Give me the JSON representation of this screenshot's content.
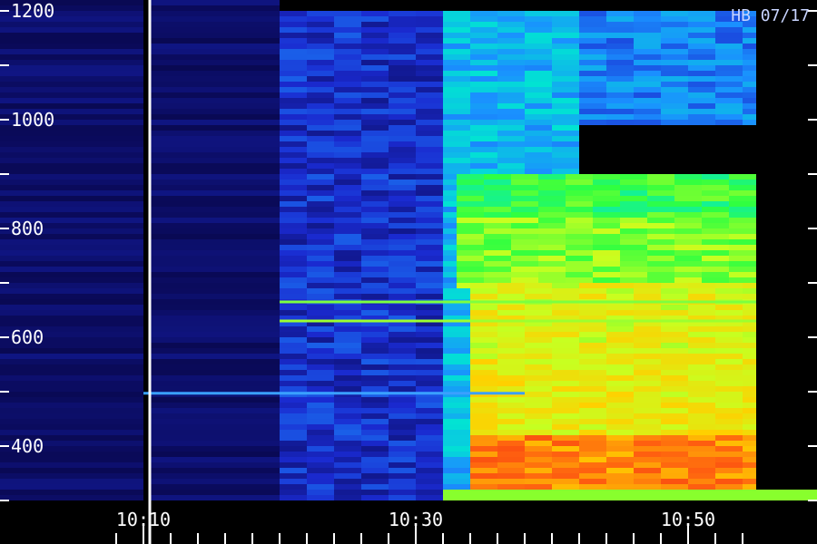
{
  "chart_data": {
    "type": "heatmap",
    "title": "",
    "corner_label": "HB 07/17",
    "xlabel": "",
    "ylabel": "",
    "x_ticks": [
      "10:10",
      "10:30",
      "10:50"
    ],
    "y_ticks": [
      400,
      600,
      800,
      1000,
      1200
    ],
    "xlim": [
      "10:07",
      "10:55"
    ],
    "ylim": [
      300,
      1200
    ],
    "grid": false,
    "legend": "none",
    "colormap": [
      "#000010",
      "#0a0a5a",
      "#1a2ad0",
      "#1a90ff",
      "#00e8d0",
      "#30ff40",
      "#c8ff20",
      "#ffd000",
      "#ff6010",
      "#e81010"
    ],
    "background_color": "#000000",
    "marker_line_time": "10:10",
    "data_start_time": "10:20",
    "onset_time": "10:32",
    "step_time": "10:42",
    "intensity_regions": [
      {
        "t_start": "10:20",
        "t_end": "10:32",
        "f_low": 300,
        "f_high": 1200,
        "level": 0.22
      },
      {
        "t_start": "10:32",
        "t_end": "10:42",
        "f_low": 300,
        "f_high": 1200,
        "level": 0.38
      },
      {
        "t_start": "10:42",
        "t_end": "10:55",
        "f_low": 1000,
        "f_high": 1200,
        "level": 0.32
      },
      {
        "t_start": "10:33",
        "t_end": "10:55",
        "f_low": 820,
        "f_high": 900,
        "level": 0.55
      },
      {
        "t_start": "10:33",
        "t_end": "10:55",
        "f_low": 700,
        "f_high": 820,
        "level": 0.62
      },
      {
        "t_start": "10:34",
        "t_end": "10:55",
        "f_low": 560,
        "f_high": 700,
        "level": 0.7
      },
      {
        "t_start": "10:34",
        "t_end": "10:55",
        "f_low": 420,
        "f_high": 560,
        "level": 0.72
      },
      {
        "t_start": "10:34",
        "t_end": "10:55",
        "f_low": 320,
        "f_high": 420,
        "level": 0.85
      }
    ],
    "narrowband_lines": [
      {
        "freq": 665,
        "t_start": "10:20",
        "t_end": "10:55",
        "color": "#7cff40"
      },
      {
        "freq": 630,
        "t_start": "10:20",
        "t_end": "10:55",
        "color": "#9cff30"
      },
      {
        "freq": 497,
        "t_start": "10:10",
        "t_end": "10:38",
        "color": "#3aa0ff"
      }
    ]
  }
}
